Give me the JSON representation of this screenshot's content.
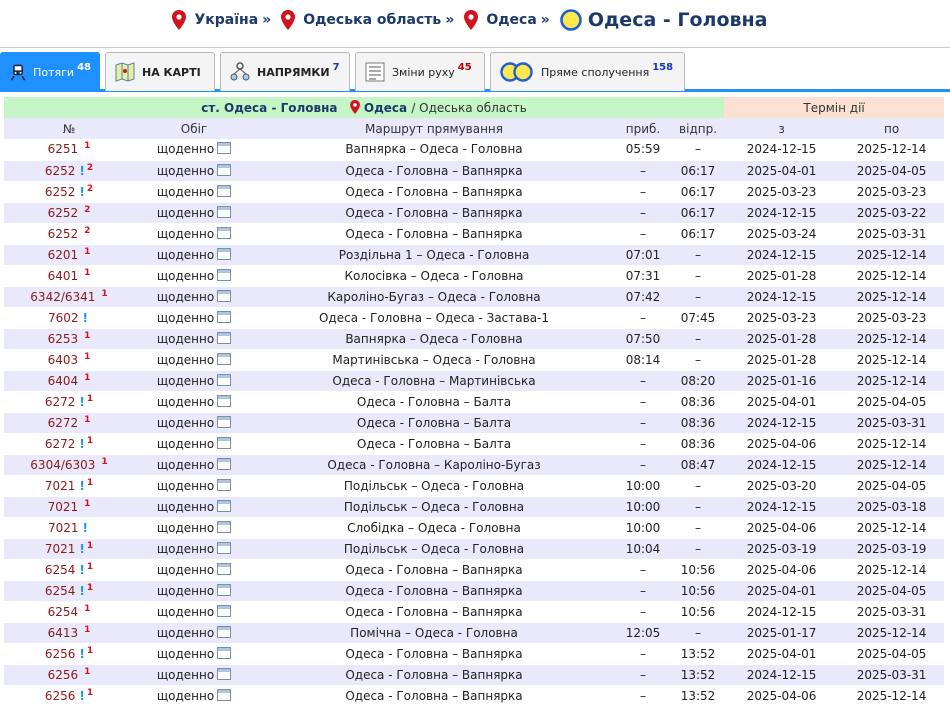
{
  "breadcrumb": {
    "items": [
      "Україна",
      "Одеська область",
      "Одеса"
    ],
    "separator": "»",
    "current": "Одеса - Головна"
  },
  "tabs": [
    {
      "label": "Потяги",
      "count": "48",
      "active": true
    },
    {
      "label": "НА КАРТІ",
      "count": ""
    },
    {
      "label": "НАПРЯМКИ",
      "count": "7"
    },
    {
      "label": "Зміни руху",
      "count": "45"
    },
    {
      "label": "Пряме сполучення",
      "count": "158"
    }
  ],
  "table": {
    "station": "ст. Одеса - Головна",
    "city": "Одеса",
    "region": "/ Одеська область",
    "term_header": "Термін дії",
    "columns": [
      "№",
      "Обіг",
      "Маршрут прямування",
      "приб.",
      "відпр.",
      "з",
      "по"
    ],
    "rows": [
      {
        "num": "6251",
        "warn": "",
        "sup": "1",
        "days": "щоденно",
        "route": "Вапнярка – Одеса - Головна",
        "arr": "05:59",
        "dep": "–",
        "from": "2024-12-15",
        "to": "2025-12-14"
      },
      {
        "num": "6252",
        "warn": "!",
        "sup": "2",
        "days": "щоденно",
        "route": "Одеса - Головна – Вапнярка",
        "arr": "–",
        "dep": "06:17",
        "from": "2025-04-01",
        "to": "2025-04-05"
      },
      {
        "num": "6252",
        "warn": "!",
        "sup": "2",
        "days": "щоденно",
        "route": "Одеса - Головна – Вапнярка",
        "arr": "–",
        "dep": "06:17",
        "from": "2025-03-23",
        "to": "2025-03-23"
      },
      {
        "num": "6252",
        "warn": "",
        "sup": "2",
        "days": "щоденно",
        "route": "Одеса - Головна – Вапнярка",
        "arr": "–",
        "dep": "06:17",
        "from": "2024-12-15",
        "to": "2025-03-22"
      },
      {
        "num": "6252",
        "warn": "",
        "sup": "2",
        "days": "щоденно",
        "route": "Одеса - Головна – Вапнярка",
        "arr": "–",
        "dep": "06:17",
        "from": "2025-03-24",
        "to": "2025-03-31"
      },
      {
        "num": "6201",
        "warn": "",
        "sup": "1",
        "days": "щоденно",
        "route": "Роздільна 1 – Одеса - Головна",
        "arr": "07:01",
        "dep": "–",
        "from": "2024-12-15",
        "to": "2025-12-14"
      },
      {
        "num": "6401",
        "warn": "",
        "sup": "1",
        "days": "щоденно",
        "route": "Колосівка – Одеса - Головна",
        "arr": "07:31",
        "dep": "–",
        "from": "2025-01-28",
        "to": "2025-12-14"
      },
      {
        "num": "6342/6341",
        "warn": "",
        "sup": "1",
        "days": "щоденно",
        "route": "Кароліно-Бугаз – Одеса - Головна",
        "arr": "07:42",
        "dep": "–",
        "from": "2024-12-15",
        "to": "2025-12-14"
      },
      {
        "num": "7602",
        "warn": "!",
        "sup": "",
        "days": "щоденно",
        "route": "Одеса - Головна – Одеса - Застава-1",
        "arr": "–",
        "dep": "07:45",
        "from": "2025-03-23",
        "to": "2025-03-23"
      },
      {
        "num": "6253",
        "warn": "",
        "sup": "1",
        "days": "щоденно",
        "route": "Вапнярка – Одеса - Головна",
        "arr": "07:50",
        "dep": "–",
        "from": "2025-01-28",
        "to": "2025-12-14"
      },
      {
        "num": "6403",
        "warn": "",
        "sup": "1",
        "days": "щоденно",
        "route": "Мартинівська – Одеса - Головна",
        "arr": "08:14",
        "dep": "–",
        "from": "2025-01-28",
        "to": "2025-12-14"
      },
      {
        "num": "6404",
        "warn": "",
        "sup": "1",
        "days": "щоденно",
        "route": "Одеса - Головна – Мартинівська",
        "arr": "–",
        "dep": "08:20",
        "from": "2025-01-16",
        "to": "2025-12-14"
      },
      {
        "num": "6272",
        "warn": "!",
        "sup": "1",
        "days": "щоденно",
        "route": "Одеса - Головна – Балта",
        "arr": "–",
        "dep": "08:36",
        "from": "2025-04-01",
        "to": "2025-04-05"
      },
      {
        "num": "6272",
        "warn": "",
        "sup": "1",
        "days": "щоденно",
        "route": "Одеса - Головна – Балта",
        "arr": "–",
        "dep": "08:36",
        "from": "2024-12-15",
        "to": "2025-03-31"
      },
      {
        "num": "6272",
        "warn": "!",
        "sup": "1",
        "days": "щоденно",
        "route": "Одеса - Головна – Балта",
        "arr": "–",
        "dep": "08:36",
        "from": "2025-04-06",
        "to": "2025-12-14"
      },
      {
        "num": "6304/6303",
        "warn": "",
        "sup": "1",
        "days": "щоденно",
        "route": "Одеса - Головна – Кароліно-Бугаз",
        "arr": "–",
        "dep": "08:47",
        "from": "2024-12-15",
        "to": "2025-12-14"
      },
      {
        "num": "7021",
        "warn": "!",
        "sup": "1",
        "days": "щоденно",
        "route": "Подільськ – Одеса - Головна",
        "arr": "10:00",
        "dep": "–",
        "from": "2025-03-20",
        "to": "2025-04-05"
      },
      {
        "num": "7021",
        "warn": "",
        "sup": "1",
        "days": "щоденно",
        "route": "Подільськ – Одеса - Головна",
        "arr": "10:00",
        "dep": "–",
        "from": "2024-12-15",
        "to": "2025-03-18"
      },
      {
        "num": "7021",
        "warn": "!",
        "sup": "",
        "days": "щоденно",
        "route": "Слобідка – Одеса - Головна",
        "arr": "10:00",
        "dep": "–",
        "from": "2025-04-06",
        "to": "2025-12-14"
      },
      {
        "num": "7021",
        "warn": "!",
        "sup": "1",
        "days": "щоденно",
        "route": "Подільськ – Одеса - Головна",
        "arr": "10:04",
        "dep": "–",
        "from": "2025-03-19",
        "to": "2025-03-19"
      },
      {
        "num": "6254",
        "warn": "!",
        "sup": "1",
        "days": "щоденно",
        "route": "Одеса - Головна – Вапнярка",
        "arr": "–",
        "dep": "10:56",
        "from": "2025-04-06",
        "to": "2025-12-14"
      },
      {
        "num": "6254",
        "warn": "!",
        "sup": "1",
        "days": "щоденно",
        "route": "Одеса - Головна – Вапнярка",
        "arr": "–",
        "dep": "10:56",
        "from": "2025-04-01",
        "to": "2025-04-05"
      },
      {
        "num": "6254",
        "warn": "",
        "sup": "1",
        "days": "щоденно",
        "route": "Одеса - Головна – Вапнярка",
        "arr": "–",
        "dep": "10:56",
        "from": "2024-12-15",
        "to": "2025-03-31"
      },
      {
        "num": "6413",
        "warn": "",
        "sup": "1",
        "days": "щоденно",
        "route": "Помічна – Одеса - Головна",
        "arr": "12:05",
        "dep": "–",
        "from": "2025-01-17",
        "to": "2025-12-14"
      },
      {
        "num": "6256",
        "warn": "!",
        "sup": "1",
        "days": "щоденно",
        "route": "Одеса - Головна – Вапнярка",
        "arr": "–",
        "dep": "13:52",
        "from": "2025-04-01",
        "to": "2025-04-05"
      },
      {
        "num": "6256",
        "warn": "",
        "sup": "1",
        "days": "щоденно",
        "route": "Одеса - Головна – Вапнярка",
        "arr": "–",
        "dep": "13:52",
        "from": "2024-12-15",
        "to": "2025-03-31"
      },
      {
        "num": "6256",
        "warn": "!",
        "sup": "1",
        "days": "щоденно",
        "route": "Одеса - Головна – Вапнярка",
        "arr": "–",
        "dep": "13:52",
        "from": "2025-04-06",
        "to": "2025-12-14"
      }
    ]
  }
}
